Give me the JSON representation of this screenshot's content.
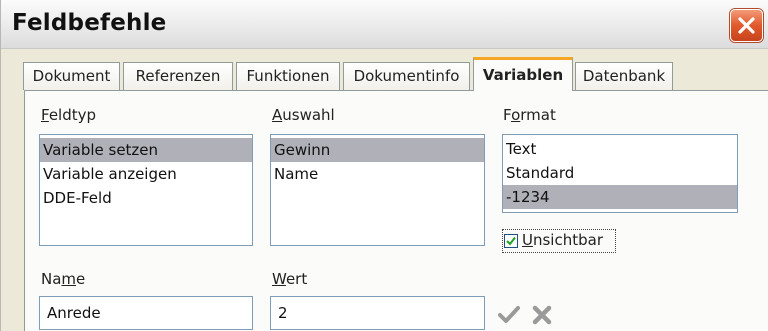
{
  "window": {
    "title": "Feldbefehle"
  },
  "tabs": [
    {
      "label": "Dokument"
    },
    {
      "label": "Referenzen"
    },
    {
      "label": "Funktionen"
    },
    {
      "label": "Dokumentinfo"
    },
    {
      "label": "Variablen",
      "active": true
    },
    {
      "label": "Datenbank"
    }
  ],
  "feldtyp": {
    "label_prefix": "",
    "label_mnemonic": "F",
    "label_rest": "eldtyp",
    "items": [
      "Variable setzen",
      "Variable anzeigen",
      "DDE-Feld"
    ],
    "selected": "Variable setzen"
  },
  "auswahl": {
    "label_mnemonic": "A",
    "label_rest": "uswahl",
    "items": [
      "Gewinn",
      "Name"
    ],
    "selected": "Gewinn"
  },
  "format": {
    "label_prefix": "F",
    "label_mnemonic": "o",
    "label_rest": "rmat",
    "items": [
      "Text",
      "Standard",
      "-1234"
    ],
    "selected": "-1234"
  },
  "unsichtbar": {
    "label_mnemonic": "U",
    "label_rest": "nsichtbar",
    "checked": true
  },
  "name": {
    "label_prefix": "Na",
    "label_mnemonic": "m",
    "label_rest": "e",
    "value": "Anrede"
  },
  "wert": {
    "label_mnemonic": "W",
    "label_rest": "ert",
    "value": "2"
  },
  "icons": {
    "apply": "checkmark-icon",
    "delete": "x-icon",
    "close": "close-icon"
  },
  "colors": {
    "selection": "#b0b0b8",
    "active_tab_accent": "#f5a623",
    "close_button": "#e05a2c"
  }
}
